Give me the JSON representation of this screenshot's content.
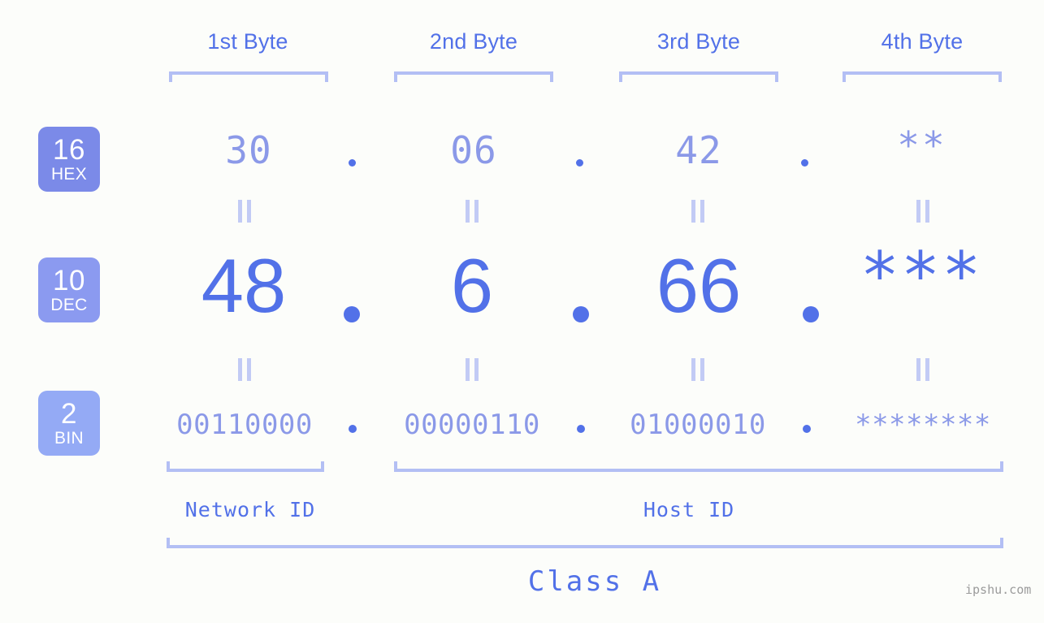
{
  "background_color": "#fcfdfa",
  "accent_color": "#5271e8",
  "accent_light_color": "#8b99e8",
  "bracket_color": "#b3bff4",
  "byte_headers": [
    {
      "label": "1st Byte"
    },
    {
      "label": "2nd Byte"
    },
    {
      "label": "3rd Byte"
    },
    {
      "label": "4th Byte"
    }
  ],
  "rows": {
    "hex": {
      "badge_number": "16",
      "badge_name": "HEX",
      "badge_color": "#7b8ae8",
      "values": [
        "30",
        "06",
        "42",
        "**"
      ],
      "separator": "."
    },
    "dec": {
      "badge_number": "10",
      "badge_name": "DEC",
      "badge_color": "#8b9af0",
      "values": [
        "48",
        "6",
        "66",
        "***"
      ],
      "separator": "."
    },
    "bin": {
      "badge_number": "2",
      "badge_name": "BIN",
      "badge_color": "#94aaf5",
      "values": [
        "00110000",
        "00000110",
        "01000010",
        "********"
      ],
      "separator": "."
    }
  },
  "equality_symbol": "=",
  "id_labels": {
    "network": "Network ID",
    "host": "Host ID"
  },
  "class_label": "Class A",
  "watermark": "ipshu.com"
}
